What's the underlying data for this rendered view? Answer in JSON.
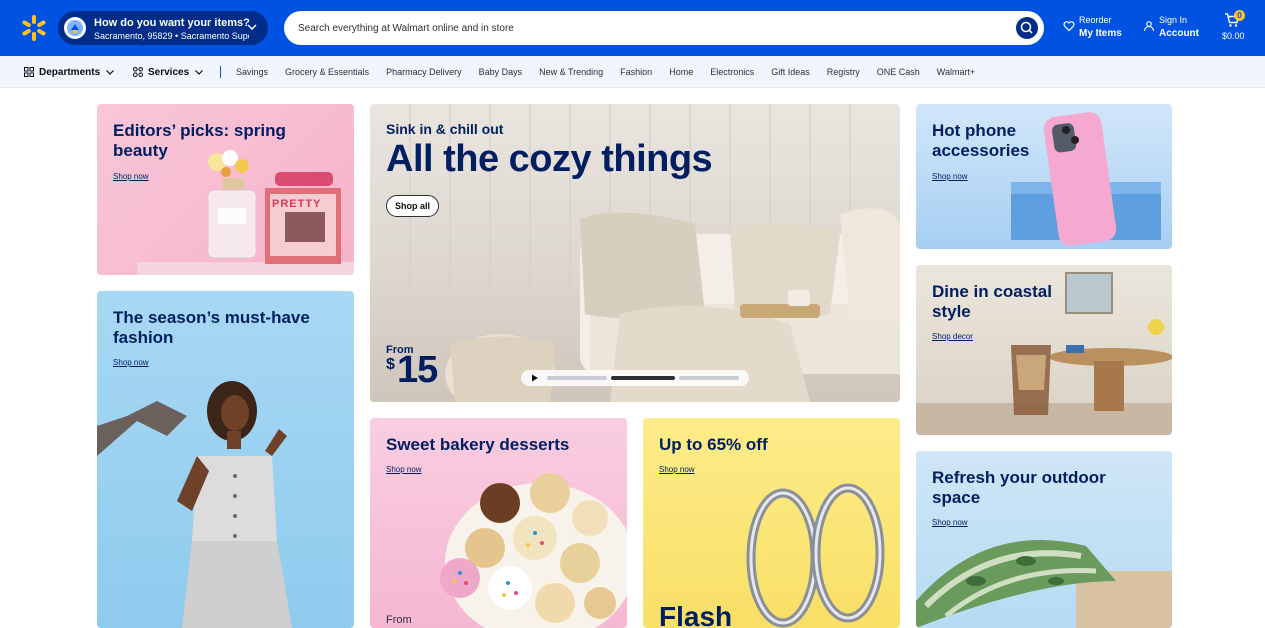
{
  "header": {
    "location_title": "How do you want your items?",
    "location_detail": "Sacramento, 95829 • Sacramento Supe...",
    "search_placeholder": "Search everything at Walmart online and in store",
    "reorder_top": "Reorder",
    "reorder_bottom": "My Items",
    "signin_top": "Sign In",
    "signin_bottom": "Account",
    "cart_count": "0",
    "cart_total": "$0.00"
  },
  "subnav": {
    "departments": "Departments",
    "services": "Services",
    "links": [
      "Savings",
      "Grocery & Essentials",
      "Pharmacy Delivery",
      "Baby Days",
      "New & Trending",
      "Fashion",
      "Home",
      "Electronics",
      "Gift Ideas",
      "Registry",
      "ONE Cash",
      "Walmart+"
    ]
  },
  "cards": {
    "editors": {
      "title": "Editors’ picks: spring beauty",
      "link": "Shop now",
      "brand_text": "PRETTY"
    },
    "fashion": {
      "title": "The season’s must-have fashion",
      "link": "Shop now"
    },
    "hero": {
      "eyebrow": "Sink in & chill out",
      "title": "All the cozy things",
      "button": "Shop all",
      "from": "From",
      "dollar": "$",
      "price": "15"
    },
    "phone": {
      "title": "Hot phone accessories",
      "link": "Shop now"
    },
    "coastal": {
      "title": "Dine in coastal style",
      "link": "Shop decor"
    },
    "bakery": {
      "title": "Sweet bakery desserts",
      "link": "Shop now",
      "from": "From"
    },
    "deals": {
      "title": "Up to 65% off",
      "link": "Shop now",
      "flash": "Flash"
    },
    "outdoor": {
      "title": "Refresh your outdoor space",
      "link": "Shop now"
    }
  },
  "colors": {
    "brand_blue": "#0053e2",
    "navy": "#001e60",
    "spark_yellow": "#ffc220",
    "subnav_bg": "#f0f5ff"
  }
}
